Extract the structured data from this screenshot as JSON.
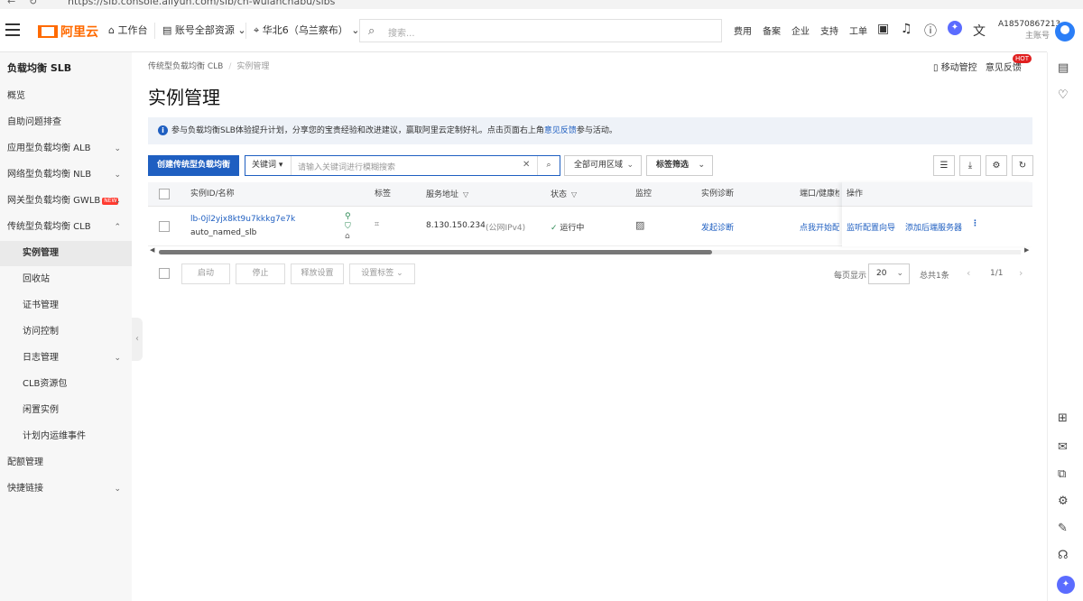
{
  "browser": {
    "url": "https://slb.console.aliyun.com/slb/cn-wulanchabu/slbs"
  },
  "topbar": {
    "logo": "阿里云",
    "workbench": "工作台",
    "resource_scope": "账号全部资源",
    "region": "华北6（乌兰察布）",
    "search_placeholder": "搜索...",
    "links": [
      "费用",
      "备案",
      "企业",
      "支持",
      "工单"
    ],
    "account_name": "A18570867213",
    "account_type": "主账号"
  },
  "sidebar": {
    "title": "负载均衡 SLB",
    "items": [
      {
        "label": "概览"
      },
      {
        "label": "自助问题排查"
      },
      {
        "label": "应用型负载均衡 ALB"
      },
      {
        "label": "网络型负载均衡 NLB"
      },
      {
        "label": "网关型负载均衡 GWLB",
        "badge": "NEW"
      },
      {
        "label": "传统型负载均衡 CLB"
      },
      {
        "label": "实例管理"
      },
      {
        "label": "回收站"
      },
      {
        "label": "证书管理"
      },
      {
        "label": "访问控制"
      },
      {
        "label": "日志管理"
      },
      {
        "label": "CLB资源包"
      },
      {
        "label": "闲置实例"
      },
      {
        "label": "计划内运维事件"
      },
      {
        "label": "配额管理"
      },
      {
        "label": "快捷链接"
      }
    ]
  },
  "breadcrumb": [
    "传统型负载均衡 CLB",
    "实例管理"
  ],
  "page_title": "实例管理",
  "header_tools": {
    "mobile": "移动管控",
    "feedback": "意见反馈",
    "hot": "HOT"
  },
  "notice": {
    "text": "参与负载均衡SLB体验提升计划，分享您的宝贵经验和改进建议，赢取阿里云定制好礼。点击页面右上角",
    "link": "意见反馈",
    "suffix": "参与活动。"
  },
  "toolbar": {
    "create_button": "创建传统型负载均衡",
    "search_field": "关键词",
    "search_placeholder": "请输入关键词进行模糊搜索",
    "zone_filter": "全部可用区域",
    "tag_filter": "标签筛选"
  },
  "table": {
    "headers": [
      "实例ID/名称",
      "标签",
      "服务地址",
      "状态",
      "监控",
      "实例诊断",
      "端口/健康检",
      "操作"
    ],
    "rows": [
      {
        "id": "lb-0jl2yjx8kt9u7kkkg7e7k",
        "name": "auto_named_slb",
        "address": "8.130.150.234",
        "address_type": "(公网IPv4)",
        "status": "运行中",
        "diagnose": "发起诊断",
        "port": "点我开始配",
        "actions": [
          "监听配置向导",
          "添加后端服务器"
        ]
      }
    ]
  },
  "bulk_actions": [
    "启动",
    "停止",
    "释放设置",
    "设置标签"
  ],
  "pagination": {
    "per_page_label": "每页显示",
    "per_page": "20",
    "total": "总共1条",
    "page": "1/1"
  },
  "colors": {
    "primary": "#1f5fc1",
    "brand": "#ff6a00",
    "hot": "#e02020"
  }
}
